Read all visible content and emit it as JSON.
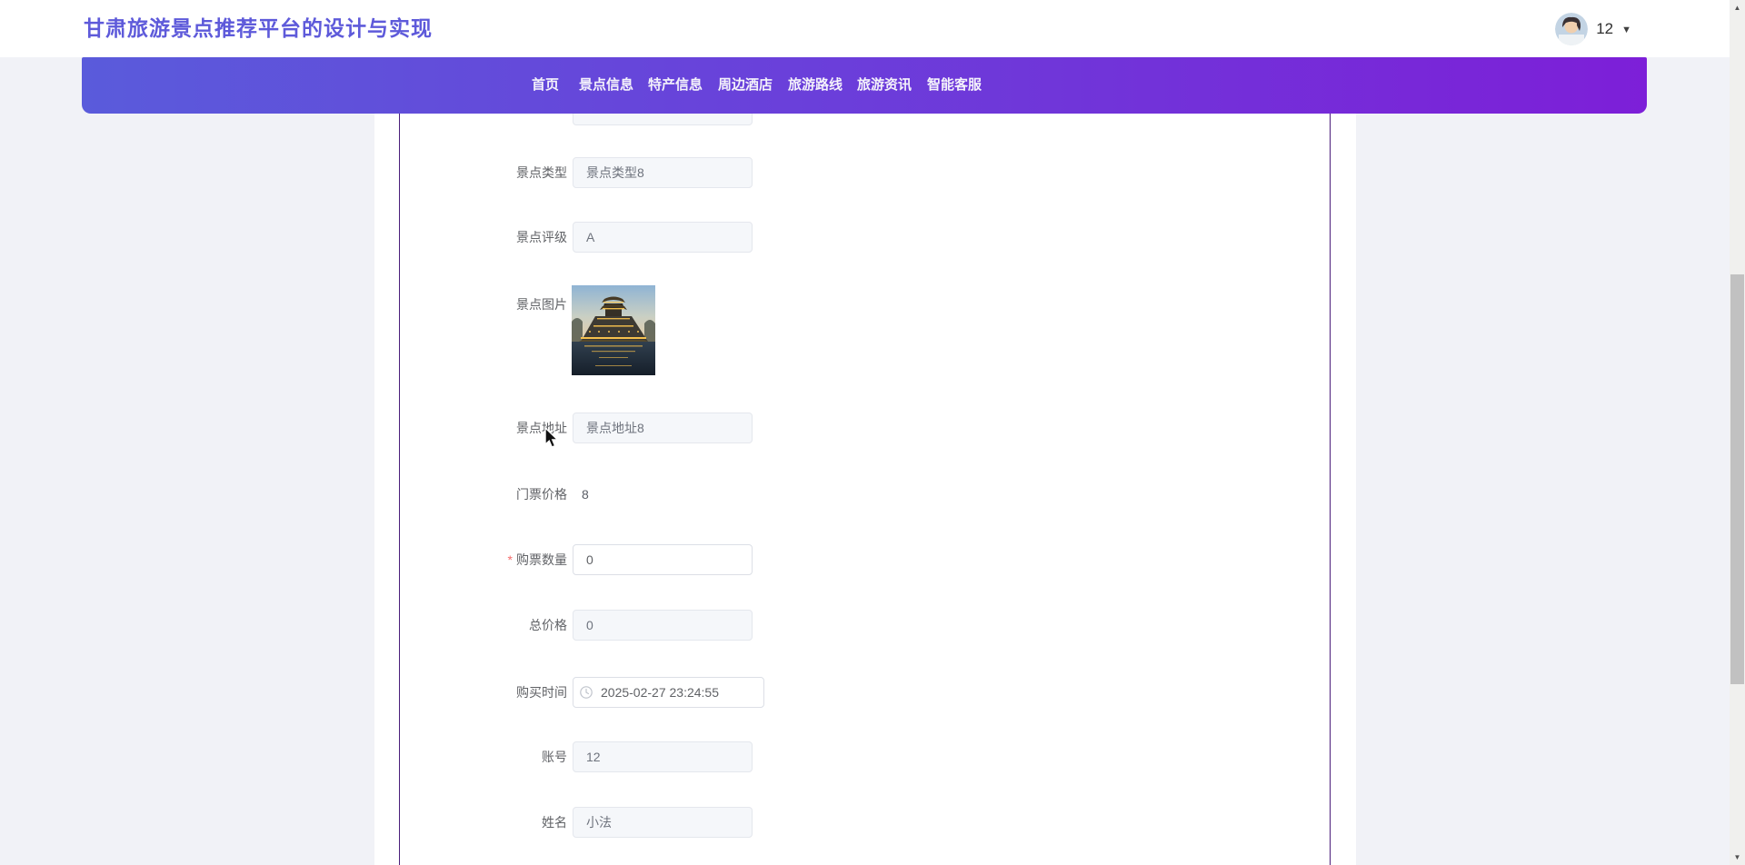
{
  "header": {
    "title": "甘肃旅游景点推荐平台的设计与实现",
    "user": {
      "name": "12"
    }
  },
  "nav": {
    "items": [
      {
        "label": "首页"
      },
      {
        "label": "景点信息"
      },
      {
        "label": "特产信息"
      },
      {
        "label": "周边酒店"
      },
      {
        "label": "旅游路线"
      },
      {
        "label": "旅游资讯"
      },
      {
        "label": "智能客服"
      }
    ]
  },
  "form": {
    "required_mark": "*",
    "rows": [
      {
        "label": "景点类型",
        "value": "景点类型8",
        "state": "disabled"
      },
      {
        "label": "景点评级",
        "value": "A",
        "state": "disabled"
      },
      {
        "label": "景点图片",
        "value": "",
        "state": "image"
      },
      {
        "label": "景点地址",
        "value": "景点地址8",
        "state": "disabled"
      },
      {
        "label": "门票价格",
        "value": "8",
        "state": "text"
      },
      {
        "label": "购票数量",
        "value": "0",
        "state": "editable",
        "required": true
      },
      {
        "label": "总价格",
        "value": "0",
        "state": "disabled"
      },
      {
        "label": "购买时间",
        "value": "2025-02-27 23:24:55",
        "state": "datetime"
      },
      {
        "label": "账号",
        "value": "12",
        "state": "disabled"
      },
      {
        "label": "姓名",
        "value": "小法",
        "state": "disabled"
      }
    ]
  },
  "icons": {
    "caret_down": "▼",
    "scroll_up": "▲",
    "scroll_down": "▼",
    "clock": "clock-icon"
  },
  "colors": {
    "title": "#5e5ada",
    "nav_gradient_left": "#5a5bdb",
    "nav_gradient_right": "#7d1fd8",
    "panel_border": "#4a1d7a",
    "required": "#f56c6c",
    "page_background": "#f1f2f7"
  }
}
